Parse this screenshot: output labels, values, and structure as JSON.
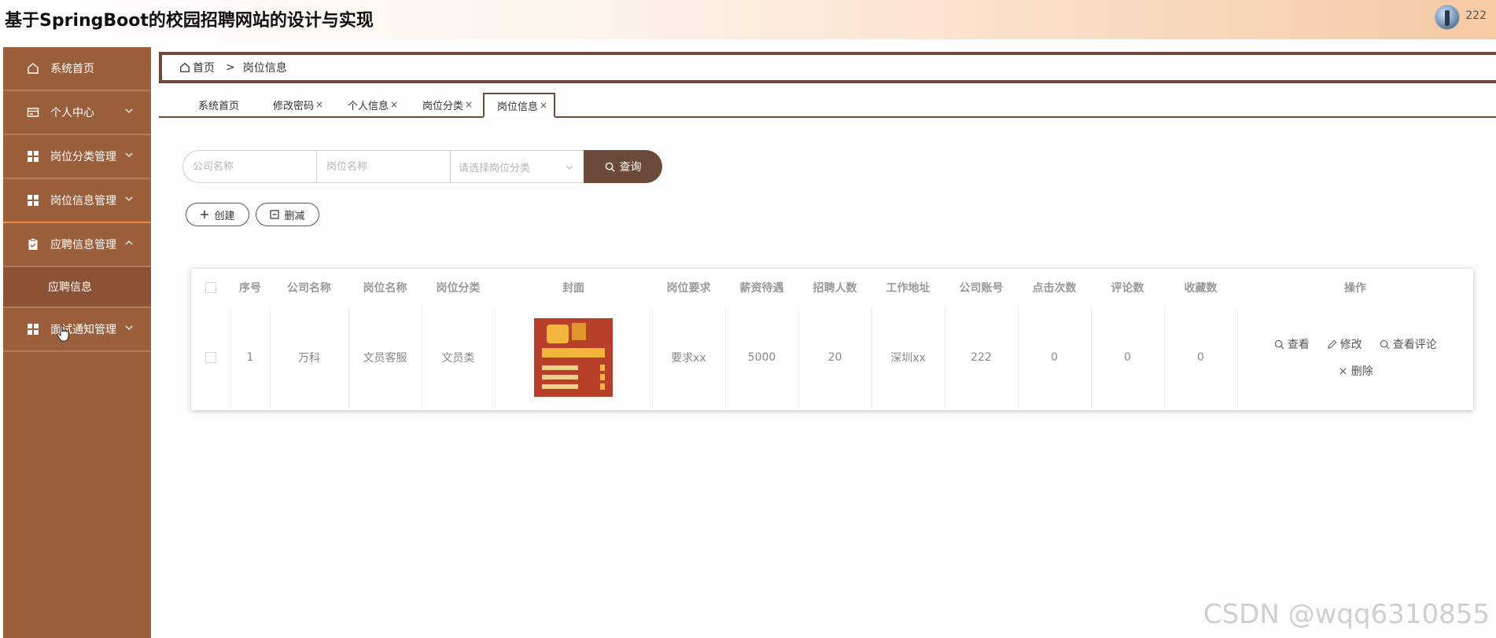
{
  "header": {
    "title": "基于SpringBoot的校园招聘网站的设计与实现",
    "username": "222"
  },
  "sidebar": {
    "items": [
      {
        "label": "系统首页",
        "icon": "home-icon"
      },
      {
        "label": "个人中心",
        "icon": "card-icon"
      },
      {
        "label": "岗位分类管理",
        "icon": "grid-icon"
      },
      {
        "label": "岗位信息管理",
        "icon": "grid-icon"
      },
      {
        "label": "应聘信息管理",
        "icon": "clipboard-icon"
      },
      {
        "label": "面试通知管理",
        "icon": "grid-icon"
      }
    ],
    "submenu": {
      "label": "应聘信息"
    }
  },
  "breadcrumb": {
    "home": "首页",
    "separator": ">",
    "current": "岗位信息"
  },
  "tabs": [
    {
      "label": "系统首页",
      "closable": false
    },
    {
      "label": "修改密码",
      "closable": true
    },
    {
      "label": "个人信息",
      "closable": true
    },
    {
      "label": "岗位分类",
      "closable": true
    },
    {
      "label": "岗位信息",
      "closable": true
    }
  ],
  "tab_close": "×",
  "search": {
    "company_placeholder": "公司名称",
    "position_placeholder": "岗位名称",
    "category_placeholder": "请选择岗位分类",
    "query_label": "查询"
  },
  "actions": {
    "create_label": "创建",
    "delete_label": "删减"
  },
  "table": {
    "columns": [
      "序号",
      "公司名称",
      "岗位名称",
      "岗位分类",
      "封面",
      "岗位要求",
      "薪资待遇",
      "招聘人数",
      "工作地址",
      "公司账号",
      "点击次数",
      "评论数",
      "收藏数",
      "操作"
    ],
    "rows": [
      {
        "index": "1",
        "company": "万科",
        "position": "文员客服",
        "category": "文员类",
        "requirement": "要求xx",
        "salary": "5000",
        "headcount": "20",
        "address": "深圳xx",
        "account": "222",
        "clicks": "0",
        "comments": "0",
        "favorites": "0"
      }
    ],
    "operations": {
      "view": "查看",
      "edit": "修改",
      "view_comments": "查看评论",
      "delete": "删除"
    }
  },
  "watermark": "CSDN @wqq6310855",
  "colors": {
    "sidebar": "#9b5f3c",
    "accent": "#6b4a3a",
    "active_line": "#f0883a"
  }
}
